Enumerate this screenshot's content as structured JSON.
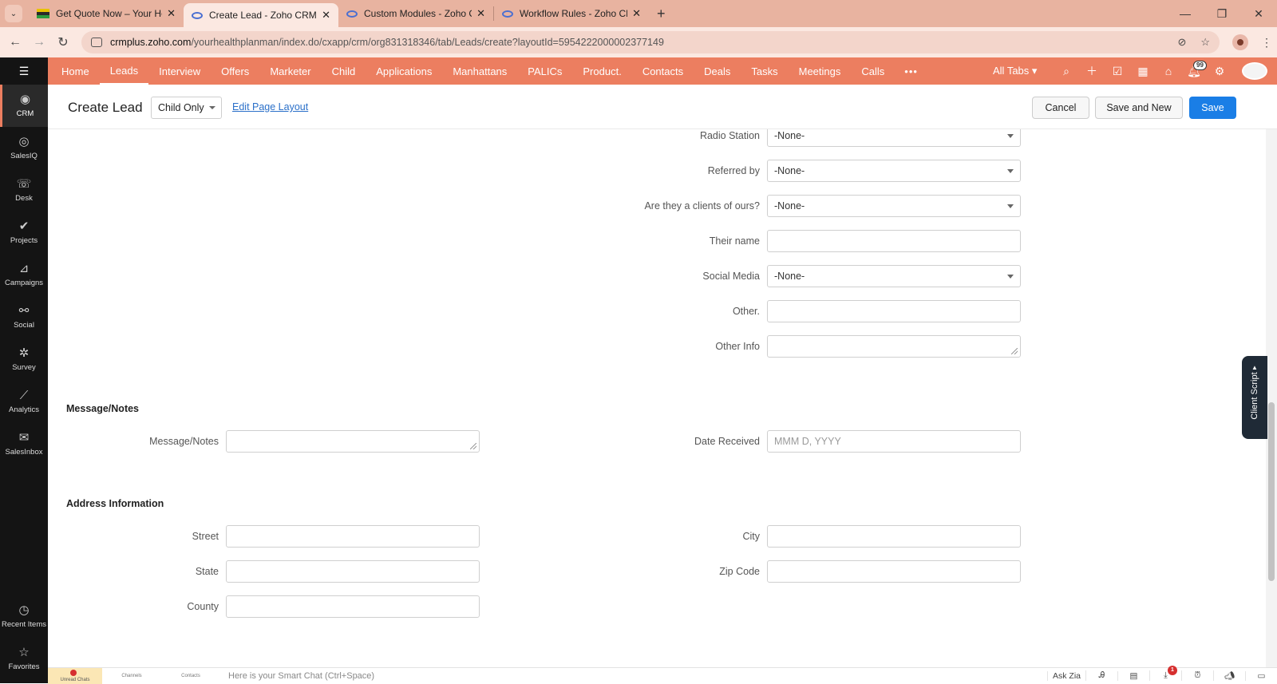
{
  "browser": {
    "tabs": [
      {
        "title": "Get Quote Now – Your Health P",
        "icon": "flag-favicon"
      },
      {
        "title": "Create Lead - Zoho CRM",
        "icon": "zoho-eye-favicon",
        "active": true
      },
      {
        "title": "Custom Modules - Zoho CRM",
        "icon": "zoho-eye-favicon"
      },
      {
        "title": "Workflow Rules - Zoho CRM",
        "icon": "zoho-eye-favicon"
      }
    ],
    "new_tab": "+",
    "url_host": "crmplus.zoho.com",
    "url_path": "/yourhealthplanman/index.do/cxapp/crm/org831318346/tab/Leads/create?layoutId=5954222000002377149"
  },
  "topnav": {
    "items": [
      "Home",
      "Leads",
      "Interview",
      "Offers",
      "Marketer",
      "Child",
      "Applications",
      "Manhattans",
      "PALICs",
      "Product.",
      "Contacts",
      "Deals",
      "Tasks",
      "Meetings",
      "Calls"
    ],
    "active": "Leads",
    "more": "•••",
    "all_tabs": "All Tabs ▾",
    "notif_count": "99"
  },
  "sidebar": {
    "items": [
      {
        "label": "CRM",
        "icon": "eye-icon"
      },
      {
        "label": "SalesIQ",
        "icon": "salesiq-icon"
      },
      {
        "label": "Desk",
        "icon": "desk-icon"
      },
      {
        "label": "Projects",
        "icon": "check-icon"
      },
      {
        "label": "Campaigns",
        "icon": "megaphone-icon"
      },
      {
        "label": "Social",
        "icon": "social-icon"
      },
      {
        "label": "Survey",
        "icon": "survey-icon"
      },
      {
        "label": "Analytics",
        "icon": "analytics-icon"
      },
      {
        "label": "SalesInbox",
        "icon": "inbox-icon"
      }
    ],
    "bottom": [
      {
        "label": "Recent Items",
        "icon": "clock-icon"
      },
      {
        "label": "Favorites",
        "icon": "star-icon"
      }
    ]
  },
  "header": {
    "title": "Create Lead",
    "layout": "Child Only",
    "edit_layout": "Edit Page Layout",
    "cancel": "Cancel",
    "save_and_new": "Save and New",
    "save": "Save"
  },
  "form": {
    "radio_station": {
      "label": "Radio Station",
      "value": "-None-"
    },
    "referred_by": {
      "label": "Referred by",
      "value": "-None-"
    },
    "are_clients": {
      "label": "Are they a clients of ours?",
      "value": "-None-"
    },
    "their_name": {
      "label": "Their name",
      "value": ""
    },
    "social_media": {
      "label": "Social Media",
      "value": "-None-"
    },
    "other": {
      "label": "Other.",
      "value": ""
    },
    "other_info": {
      "label": "Other Info",
      "value": ""
    },
    "message_section": "Message/Notes",
    "message_notes": {
      "label": "Message/Notes",
      "value": ""
    },
    "date_received": {
      "label": "Date Received",
      "placeholder": "MMM D, YYYY"
    },
    "address_section": "Address Information",
    "street": {
      "label": "Street",
      "value": ""
    },
    "city": {
      "label": "City",
      "value": ""
    },
    "state": {
      "label": "State",
      "value": ""
    },
    "zip": {
      "label": "Zip Code",
      "value": ""
    },
    "county": {
      "label": "County",
      "value": ""
    }
  },
  "client_script": "Client Script",
  "bottombar": {
    "unread_chats": "Unread Chats",
    "channels": "Channels",
    "contacts": "Contacts",
    "smart_chat": "Here is your Smart Chat (Ctrl+Space)",
    "ask_zia": "Ask Zia",
    "badge": "1"
  }
}
